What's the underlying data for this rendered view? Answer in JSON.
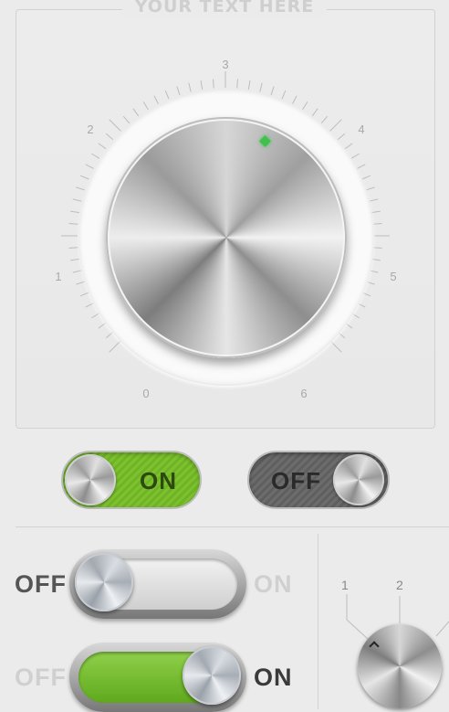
{
  "header": {
    "title": "YOUR TEXT HERE"
  },
  "dial": {
    "labels": [
      "0",
      "1",
      "2",
      "3",
      "4",
      "5",
      "6"
    ],
    "value": 3.6,
    "indicator_color": "#3fc14b"
  },
  "toggles": {
    "on_pill": {
      "label": "ON",
      "state": true,
      "color": "#7dc12f"
    },
    "off_pill": {
      "label": "OFF",
      "state": false,
      "color": "#666666"
    }
  },
  "switches": [
    {
      "off_label": "OFF",
      "on_label": "ON",
      "state": false
    },
    {
      "off_label": "OFF",
      "on_label": "ON",
      "state": true
    }
  ],
  "mini_dial": {
    "labels": [
      "1",
      "2"
    ]
  }
}
